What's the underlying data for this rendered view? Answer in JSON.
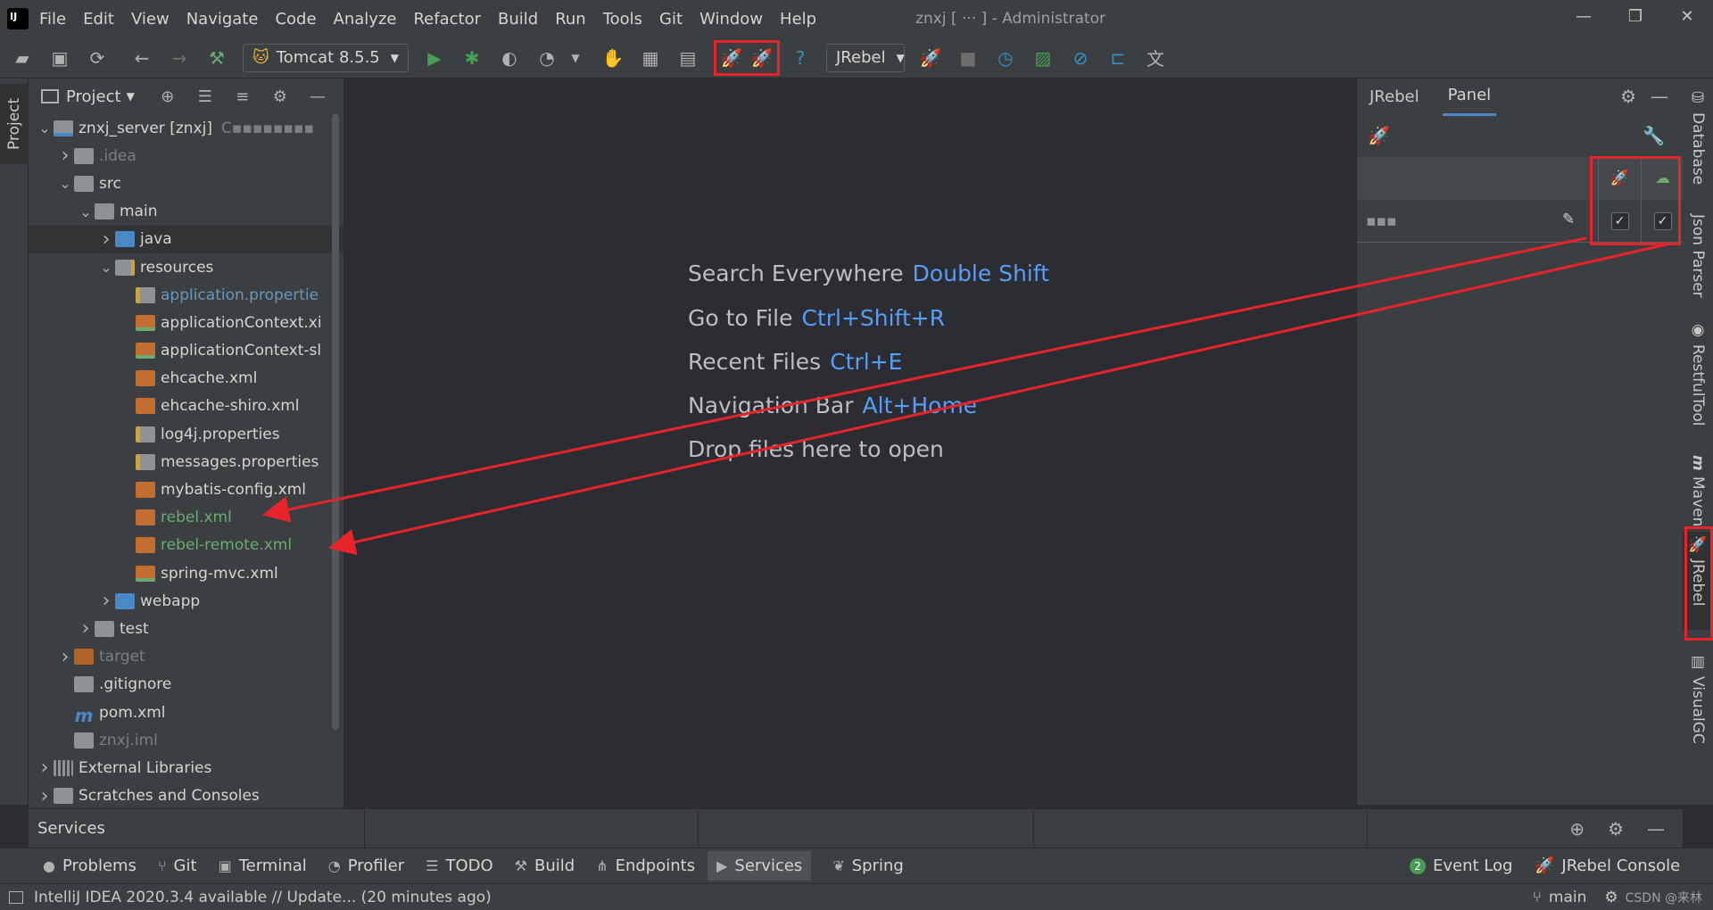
{
  "menubar": {
    "items": [
      "File",
      "Edit",
      "View",
      "Navigate",
      "Code",
      "Analyze",
      "Refactor",
      "Build",
      "Run",
      "Tools",
      "Git",
      "Window",
      "Help"
    ],
    "title": "znxj [ ··· ] - Administrator"
  },
  "toolbar": {
    "run_config": "Tomcat 8.5.5",
    "jrebel_config": "JRebel",
    "icons": [
      "open-icon",
      "save-icon",
      "sync-icon",
      "back-icon",
      "forward-icon",
      "build-hammer-icon",
      "run-icon",
      "debug-icon",
      "coverage-icon",
      "profile-icon",
      "more-icon",
      "attach-icon",
      "update-icon",
      "stop-build-icon",
      "jrebel-run-icon",
      "jrebel-debug-icon",
      "help-icon",
      "jrebel-icon",
      "stop-icon",
      "gauge-icon",
      "monitor-icon",
      "disable-icon",
      "link-icon",
      "translate-icon"
    ]
  },
  "left_strip": {
    "tab": "Project"
  },
  "project": {
    "header": "Project",
    "tree": [
      {
        "label": "znxj_server [znxj]",
        "suffix": "C▪▪▪▪▪▪▪▪",
        "indent": 0,
        "arrow": "v",
        "icon": "module",
        "style": ""
      },
      {
        "label": ".idea",
        "indent": 1,
        "arrow": ">",
        "icon": "folder",
        "style": "gray"
      },
      {
        "label": "src",
        "indent": 1,
        "arrow": "v",
        "icon": "folder",
        "style": ""
      },
      {
        "label": "main",
        "indent": 2,
        "arrow": "v",
        "icon": "folder",
        "style": ""
      },
      {
        "label": "java",
        "indent": 3,
        "arrow": ">",
        "icon": "folder-blue",
        "style": "",
        "selected": true
      },
      {
        "label": "resources",
        "indent": 3,
        "arrow": "v",
        "icon": "folder-res",
        "style": ""
      },
      {
        "label": "application.propertie",
        "indent": 4,
        "arrow": "",
        "icon": "props",
        "style": "blue"
      },
      {
        "label": "applicationContext.xi",
        "indent": 4,
        "arrow": "",
        "icon": "xml-spring",
        "style": ""
      },
      {
        "label": "applicationContext-sl",
        "indent": 4,
        "arrow": "",
        "icon": "xml-spring",
        "style": ""
      },
      {
        "label": "ehcache.xml",
        "indent": 4,
        "arrow": "",
        "icon": "xml",
        "style": ""
      },
      {
        "label": "ehcache-shiro.xml",
        "indent": 4,
        "arrow": "",
        "icon": "xml",
        "style": ""
      },
      {
        "label": "log4j.properties",
        "indent": 4,
        "arrow": "",
        "icon": "props",
        "style": ""
      },
      {
        "label": "messages.properties",
        "indent": 4,
        "arrow": "",
        "icon": "props",
        "style": ""
      },
      {
        "label": "mybatis-config.xml",
        "indent": 4,
        "arrow": "",
        "icon": "xml",
        "style": ""
      },
      {
        "label": "rebel.xml",
        "indent": 4,
        "arrow": "",
        "icon": "xml",
        "style": "green"
      },
      {
        "label": "rebel-remote.xml",
        "indent": 4,
        "arrow": "",
        "icon": "xml",
        "style": "green"
      },
      {
        "label": "spring-mvc.xml",
        "indent": 4,
        "arrow": "",
        "icon": "xml-spring",
        "style": ""
      },
      {
        "label": "webapp",
        "indent": 3,
        "arrow": ">",
        "icon": "folder-blue",
        "style": ""
      },
      {
        "label": "test",
        "indent": 2,
        "arrow": ">",
        "icon": "folder",
        "style": ""
      },
      {
        "label": "target",
        "indent": 1,
        "arrow": ">",
        "icon": "folder-orange",
        "style": "gray"
      },
      {
        "label": ".gitignore",
        "indent": 1,
        "arrow": "",
        "icon": "file",
        "style": ""
      },
      {
        "label": "pom.xml",
        "indent": 1,
        "arrow": "",
        "icon": "maven",
        "style": ""
      },
      {
        "label": "znxj.iml",
        "indent": 1,
        "arrow": "",
        "icon": "file",
        "style": "gray"
      },
      {
        "label": "External Libraries",
        "indent": 0,
        "arrow": ">",
        "icon": "lib",
        "style": ""
      },
      {
        "label": "Scratches and Consoles",
        "indent": 0,
        "arrow": ">",
        "icon": "scratch",
        "style": ""
      }
    ]
  },
  "editor": {
    "hints": [
      {
        "label": "Search Everywhere",
        "shortcut": "Double Shift"
      },
      {
        "label": "Go to File",
        "shortcut": "Ctrl+Shift+R"
      },
      {
        "label": "Recent Files",
        "shortcut": "Ctrl+E"
      },
      {
        "label": "Navigation Bar",
        "shortcut": "Alt+Home"
      },
      {
        "label": "Drop files here to open",
        "shortcut": ""
      }
    ]
  },
  "jrebel_panel": {
    "tabs": [
      "JRebel",
      "Panel"
    ],
    "active_tab": "Panel",
    "row_label": "▪▪▪",
    "check_jrebel": "✓",
    "check_remote": "✓"
  },
  "right_strip": {
    "tabs": [
      "Database",
      "Json Parser",
      "RestfulTool",
      "Maven",
      "JRebel",
      "VisualGC"
    ]
  },
  "services": {
    "title": "Services"
  },
  "bottom_tabs": {
    "left": [
      "Problems",
      "Git",
      "Terminal",
      "Profiler",
      "TODO",
      "Build",
      "Endpoints",
      "Services",
      "Spring"
    ],
    "active": "Services",
    "event_log": "Event Log",
    "event_log_count": "2",
    "jrebel_console": "JRebel Console"
  },
  "status": {
    "message": "IntelliJ IDEA 2020.3.4 available // Update... (20 minutes ago)",
    "branch": "main",
    "watermark": "CSDN @来林"
  },
  "colors": {
    "highlight": "#e8232a",
    "accent": "#4a88c7",
    "shortcut": "#589df6",
    "green_file": "#6aab73"
  }
}
